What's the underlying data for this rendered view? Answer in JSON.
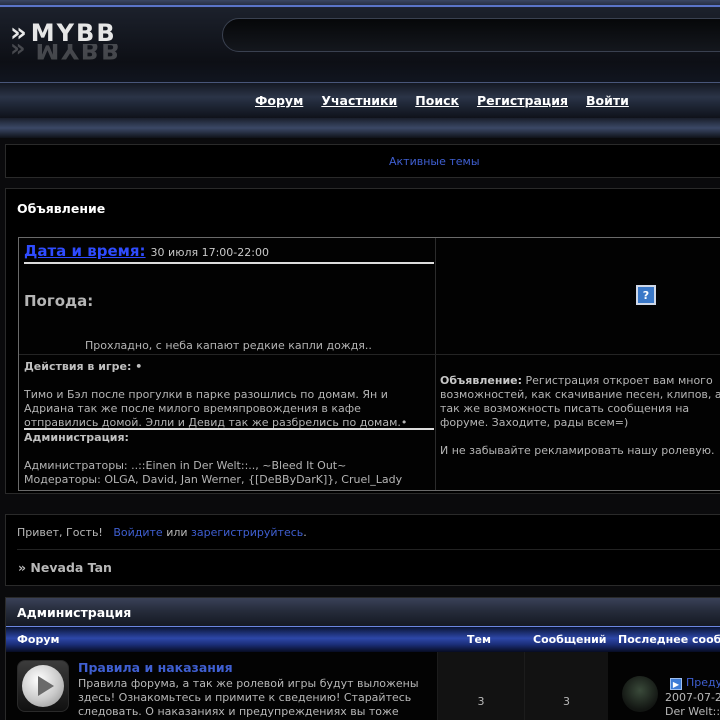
{
  "header": {
    "logo_arrows": "»",
    "logo_text": "MYBB",
    "nav": [
      "Форум",
      "Участники",
      "Поиск",
      "Регистрация",
      "Войти"
    ]
  },
  "active_topics": {
    "label": "Активные темы"
  },
  "announcement": {
    "title": "Объявление",
    "datetime_label": "Дата и время:",
    "datetime_value": "30 июля 17:00-22:00",
    "weather_label": "Погода:",
    "weather_value": "Прохладно, с неба капают редкие капли дождя..",
    "actions_label": "Действия в игре: •",
    "actions_text": "Тимо и Бэл после прогулки в парке разошлись по домам. Ян и Адриана так же после милого времяпровождения в кафе отправились домой. Элли и Девид так же разбрелись по домам.•",
    "admin_label": "Администрация:",
    "admins": "Администраторы: ..::Einen in Der Welt::.., ~Bleed It Out~",
    "moderators": "Модераторы: OLGA, David, Jan Werner, {[DeBByDarK]}, Cruel_Lady",
    "right_label": "Объявление:",
    "right_text": " Регистрация откроет вам много возможностей, как скачивание песен, клипов, а так же возможность писать сообщения на форуме. Заходите, рады всем=)",
    "right_text2": "И не забывайте рекламировать нашу ролевую.",
    "image_icon": "question-mark-icon"
  },
  "guest": {
    "greeting": "Привет, Гость!",
    "login_link": "Войдите",
    "or": "или",
    "register_link": "зарегистрируйтесь",
    "period": ".",
    "breadcrumb": "» Nevada Tan"
  },
  "category": {
    "title": "Администрация",
    "columns": {
      "forum": "Форум",
      "topics": "Тем",
      "posts": "Сообщений",
      "last": "Последнее сооб"
    },
    "forums": [
      {
        "name": "Правила и наказания",
        "description": "Правила форума, а так же ролевой игры будут выложены здесь! Ознакомьтесь и примите к сведению! Старайтесь следовать. О наказаниях и предупреждениях вы тоже",
        "topics": "3",
        "posts": "3",
        "last_link": "Преду",
        "last_date": "2007-07-2",
        "last_by": "Der Welt::"
      }
    ]
  },
  "colors": {
    "link": "#3f5fd1",
    "accent_blue": "#2d47a8",
    "background": "#000000"
  }
}
